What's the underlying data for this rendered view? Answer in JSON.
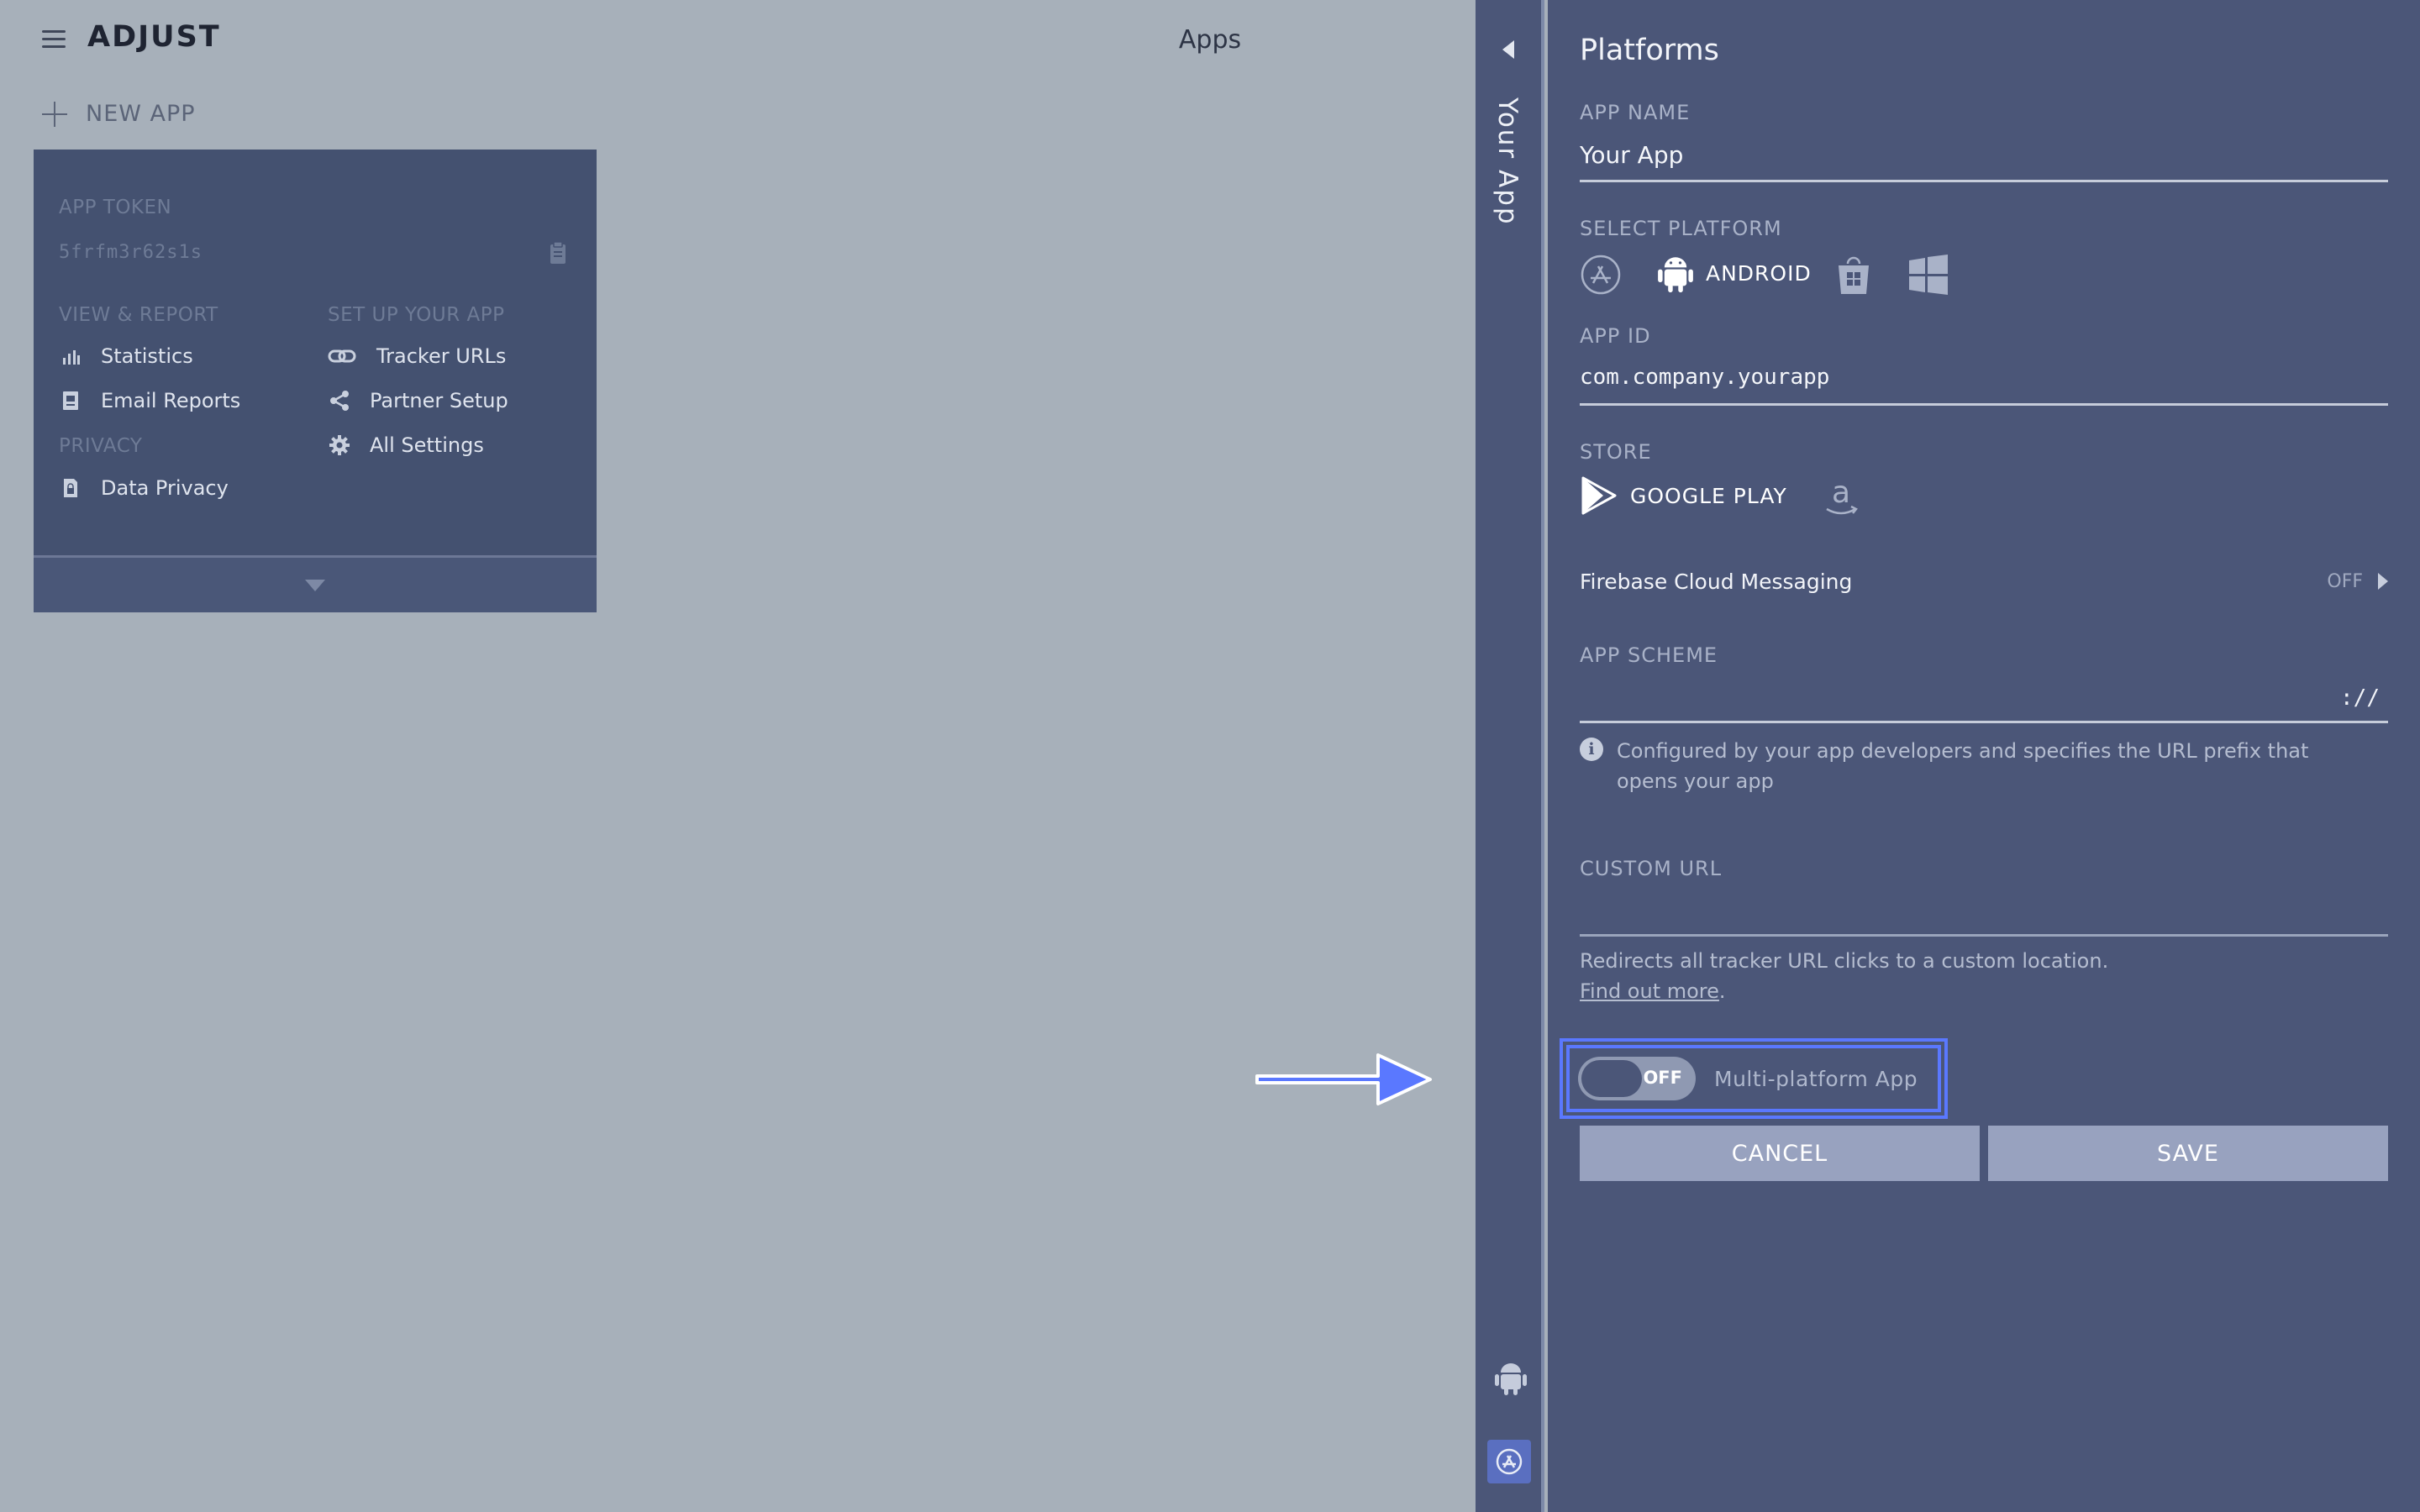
{
  "topbar": {
    "logo": "ADJUST",
    "title": "Apps",
    "new_app_label": "NEW APP"
  },
  "app_card": {
    "token_label": "APP TOKEN",
    "token_value": "5frfm3r62s1s",
    "view_report_label": "VIEW & REPORT",
    "setup_label": "SET UP YOUR APP",
    "privacy_label": "PRIVACY",
    "links": {
      "statistics": "Statistics",
      "email_reports": "Email Reports",
      "data_privacy": "Data Privacy",
      "tracker_urls": "Tracker URLs",
      "partner_setup": "Partner Setup",
      "all_settings": "All Settings"
    }
  },
  "rail": {
    "app_title": "Your App"
  },
  "panel": {
    "title": "Platforms",
    "app_name_label": "APP NAME",
    "app_name_value": "Your App",
    "select_platform_label": "SELECT PLATFORM",
    "selected_platform": "ANDROID",
    "app_id_label": "APP ID",
    "app_id_value": "com.company.yourapp",
    "store_label": "STORE",
    "selected_store": "GOOGLE PLAY",
    "fcm_label": "Firebase Cloud Messaging",
    "fcm_state": "OFF",
    "app_scheme_label": "APP SCHEME",
    "app_scheme_suffix": "://",
    "app_scheme_info": "Configured by your app developers and specifies the URL prefix that opens your app",
    "custom_url_label": "CUSTOM URL",
    "custom_url_help": "Redirects all tracker URL clicks to a custom location.",
    "find_out_more": "Find out more",
    "period": ".",
    "multiplatform_state": "OFF",
    "multiplatform_label": "Multi-platform App",
    "cancel_label": "CANCEL",
    "save_label": "SAVE"
  },
  "colors": {
    "background": "#a7b0ba",
    "card": "#445170",
    "panel": "#4b5678",
    "highlight": "#5a78ff",
    "button": "#98a2bf"
  }
}
